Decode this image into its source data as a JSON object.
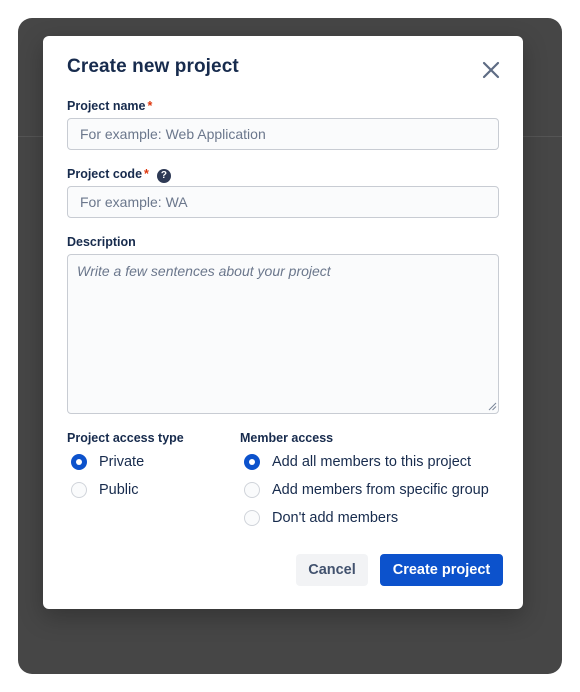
{
  "dialog": {
    "title": "Create new project"
  },
  "fields": {
    "project_name": {
      "label": "Project name",
      "required_mark": "*",
      "placeholder": "For example: Web Application",
      "value": ""
    },
    "project_code": {
      "label": "Project code",
      "required_mark": "*",
      "help_icon": "?",
      "placeholder": "For example: WA",
      "value": ""
    },
    "description": {
      "label": "Description",
      "placeholder": "Write a few sentences about your project",
      "value": ""
    }
  },
  "access_type": {
    "label": "Project access type",
    "options": [
      {
        "label": "Private",
        "checked": true
      },
      {
        "label": "Public",
        "checked": false
      }
    ]
  },
  "member_access": {
    "label": "Member access",
    "options": [
      {
        "label": "Add all members to this project",
        "checked": true
      },
      {
        "label": "Add members from specific group",
        "checked": false
      },
      {
        "label": "Don't add members",
        "checked": false
      }
    ]
  },
  "actions": {
    "cancel_label": "Cancel",
    "create_label": "Create project"
  },
  "icons": {
    "close": "close-icon",
    "help": "question-circle-icon",
    "resize": "resize-grip-icon"
  },
  "colors": {
    "primary": "#0c52cc",
    "text": "#172b4d",
    "required": "#de350b",
    "backdrop": "#464646"
  }
}
